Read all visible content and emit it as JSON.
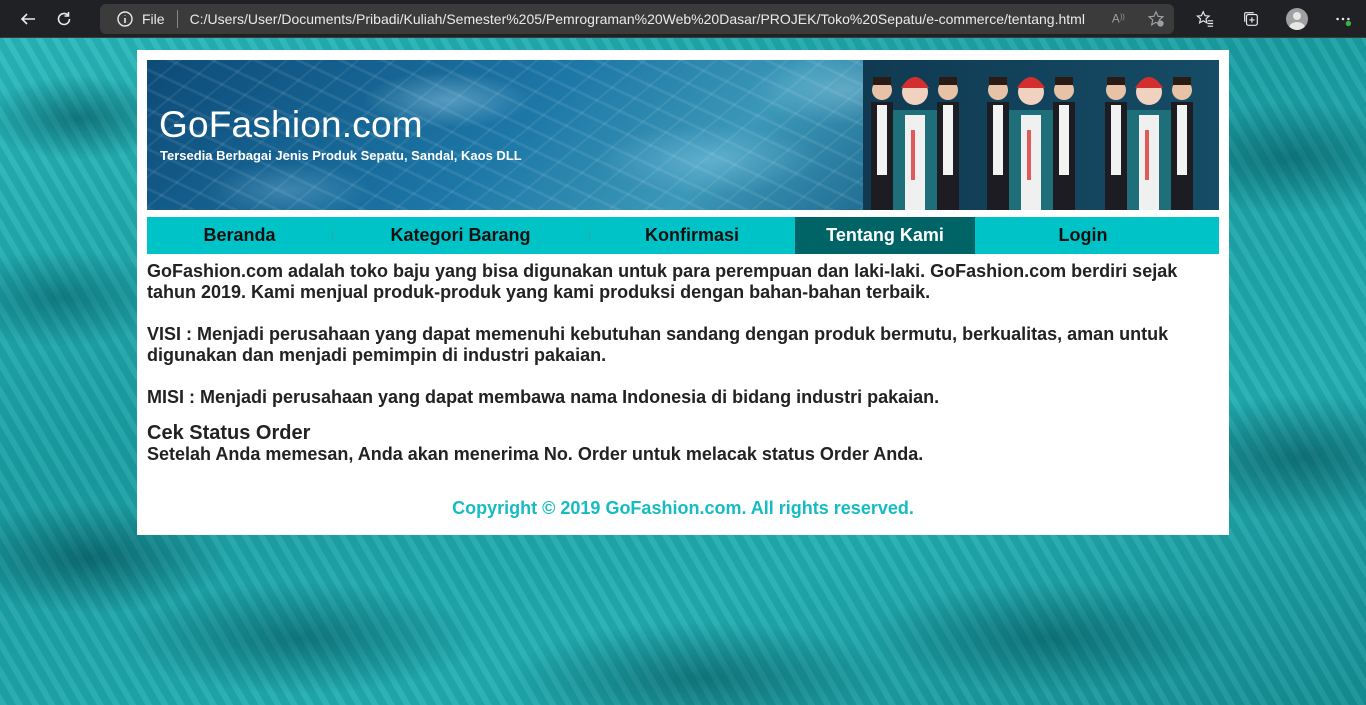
{
  "browser": {
    "scheme": "File",
    "url": "C:/Users/User/Documents/Pribadi/Kuliah/Semester%205/Pemrograman%20Web%20Dasar/PROJEK/Toko%20Sepatu/e-commerce/tentang.html",
    "icons": [
      "back-icon",
      "refresh-icon",
      "info-icon",
      "read-aloud-icon",
      "add-favorite-icon",
      "favorites-icon",
      "collections-icon",
      "profile-avatar",
      "more-icon"
    ]
  },
  "site": {
    "title": "GoFashion.com",
    "tagline": "Tersedia Berbagai Jenis Produk Sepatu, Sandal, Kaos DLL"
  },
  "nav": {
    "items": [
      {
        "label": "Beranda",
        "active": false
      },
      {
        "label": "Kategori Barang",
        "active": false
      },
      {
        "label": "Konfirmasi",
        "active": false
      },
      {
        "label": "Tentang Kami",
        "active": true
      },
      {
        "label": "Login",
        "active": false
      }
    ]
  },
  "content": {
    "intro": "GoFashion.com adalah toko baju yang bisa digunakan untuk para perempuan dan laki-laki. GoFashion.com berdiri sejak tahun 2019. Kami menjual produk-produk yang kami produksi dengan bahan-bahan terbaik.",
    "visi": "VISI : Menjadi perusahaan yang dapat memenuhi kebutuhan sandang dengan produk bermutu, berkualitas, aman untuk digunakan dan menjadi pemimpin di industri pakaian.",
    "misi": "MISI : Menjadi perusahaan yang dapat membawa nama Indonesia di bidang industri pakaian.",
    "status_heading": "Cek Status Order",
    "status_text": "Setelah Anda memesan, Anda akan menerima No. Order untuk melacak status Order Anda."
  },
  "footer": {
    "copyright": "Copyright © 2019 GoFashion.com. All rights reserved."
  },
  "colors": {
    "nav_bg": "#00c3c8",
    "nav_active": "#006366",
    "footer_text": "#15bcc2"
  }
}
